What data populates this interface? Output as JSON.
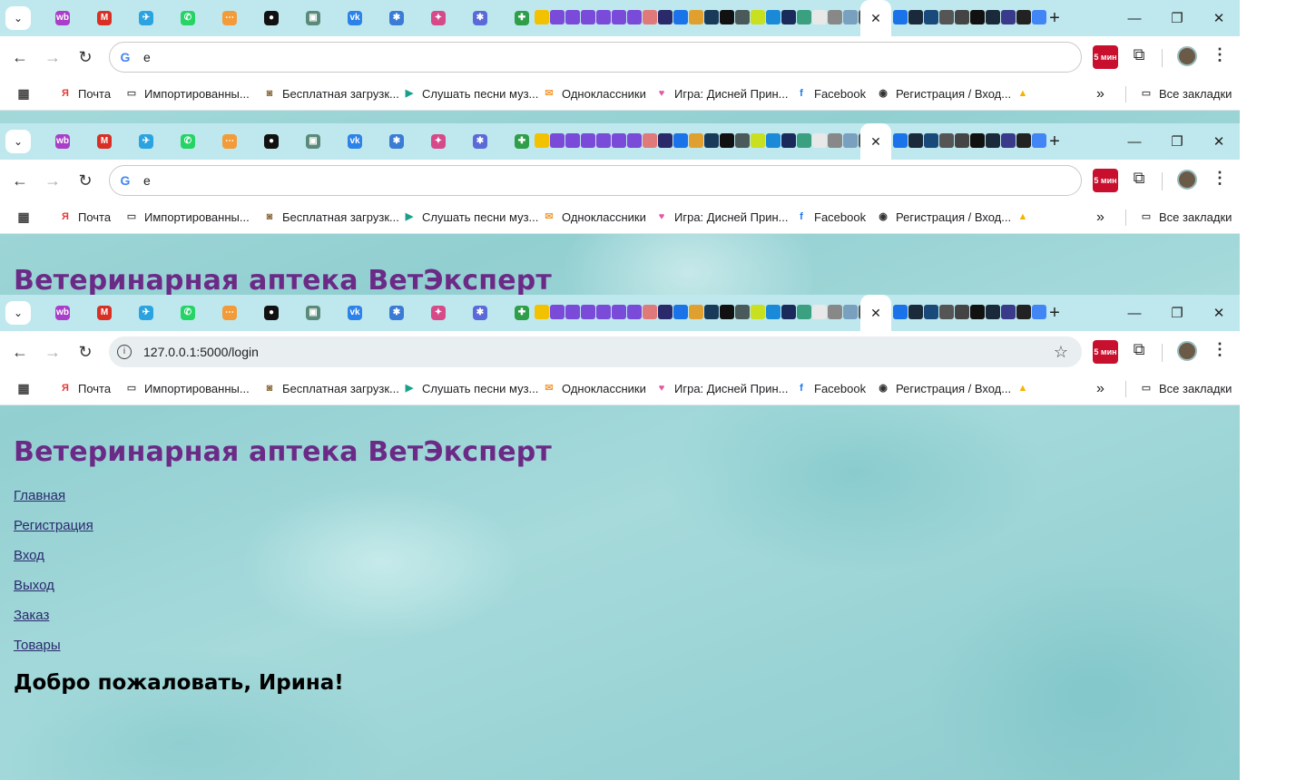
{
  "colors": {
    "tab_bar": "#bfe8ee",
    "heading": "#6b2a86",
    "link": "#2a2a6e",
    "page_bg": "#9fd6d8"
  },
  "browser": {
    "tab_menu_icon": "chevron-down-icon",
    "new_tab_symbol": "+",
    "active_tab_close": "✕",
    "window": {
      "minimize": "—",
      "restore": "❐",
      "close": "✕"
    },
    "pinned_tabs": [
      {
        "icon": "wildberries-icon",
        "text": "wb",
        "color": "#a93ec9"
      },
      {
        "icon": "gmail-icon",
        "text": "M",
        "color": "#d93025"
      },
      {
        "icon": "telegram-icon",
        "text": "✈",
        "color": "#2aa3e0"
      },
      {
        "icon": "whatsapp-icon",
        "text": "✆",
        "color": "#25d366"
      },
      {
        "icon": "orange-flow-icon",
        "text": "⋯",
        "color": "#f29b38"
      },
      {
        "icon": "github-icon",
        "text": "●",
        "color": "#111111"
      },
      {
        "icon": "robot-icon",
        "text": "▣",
        "color": "#5a8a7a"
      },
      {
        "icon": "vk-icon",
        "text": "vk",
        "color": "#2c82e8"
      },
      {
        "icon": "sparkle-icon",
        "text": "✱",
        "color": "#3a7bd5"
      },
      {
        "icon": "colorful-star-icon",
        "text": "✦",
        "color": "#d64a8a"
      },
      {
        "icon": "sparkle-icon",
        "text": "✱",
        "color": "#5a6ad8"
      },
      {
        "icon": "puzzle-icon",
        "text": "✚",
        "color": "#2e9e4a"
      }
    ],
    "mini_tab_colors": [
      "#f2c200",
      "#7a4ad8",
      "#7a4ad8",
      "#7a4ad8",
      "#7a4ad8",
      "#7a4ad8",
      "#7a4ad8",
      "#e07a7a",
      "#2a2a6a",
      "#1a73e8",
      "#e0a030",
      "#1a3a5a",
      "#111111",
      "#4a5a5a",
      "#c8e020",
      "#1a8ad8",
      "#1a2a5a",
      "#3aa080",
      "#e8e8e8",
      "#888888",
      "#7aa0c0",
      "#555555",
      "#333333"
    ],
    "mini_tab_colors_2": [
      "#1a73e8",
      "#1a2a3a",
      "#1a4a7a",
      "#555555",
      "#444444",
      "#111111",
      "#1a2a3a",
      "#3a3a8a",
      "#222222",
      "#4285f4"
    ],
    "bookmarks": [
      {
        "label": "Почта",
        "icon": "yandex-icon",
        "icon_text": "Я",
        "icon_color": "#e53935"
      },
      {
        "label": "Импортированны...",
        "icon": "folder-icon",
        "icon_text": "▭",
        "icon_color": "#555555"
      },
      {
        "label": "Бесплатная загрузк...",
        "icon": "download-site-icon",
        "icon_text": "◙",
        "icon_color": "#8a6a3a"
      },
      {
        "label": "Слушать песни муз...",
        "icon": "play-icon",
        "icon_text": "▶",
        "icon_color": "#1aa08a"
      },
      {
        "label": "Одноклассники",
        "icon": "ok-icon",
        "icon_text": "✉",
        "icon_color": "#f29b38"
      },
      {
        "label": "Игра: Дисней Прин...",
        "icon": "heart-icon",
        "icon_text": "♥",
        "icon_color": "#e05aa0"
      },
      {
        "label": "Facebook",
        "icon": "facebook-icon",
        "icon_text": "f",
        "icon_color": "#1877f2"
      },
      {
        "label": "Регистрация / Вход...",
        "icon": "globe-icon",
        "icon_text": "◉",
        "icon_color": "#333333"
      },
      {
        "label": "",
        "icon": "google-drive-icon",
        "icon_text": "▲",
        "icon_color": "#f4b400"
      }
    ],
    "overflow_chevron": "»",
    "all_bookmarks": "Все закладки",
    "ext_badge": "5 мин"
  },
  "windows": [
    {
      "address": "e",
      "address_type": "search"
    },
    {
      "address": "e",
      "address_type": "search"
    },
    {
      "address": "127.0.0.1:5000/login",
      "address_type": "url"
    }
  ],
  "page": {
    "title": "Ветеринарная аптека ВетЭксперт",
    "nav": [
      "Главная",
      "Регистрация",
      "Вход",
      "Выход",
      "Заказ",
      "Товары"
    ],
    "welcome": "Добро пожаловать, Ирина!"
  }
}
